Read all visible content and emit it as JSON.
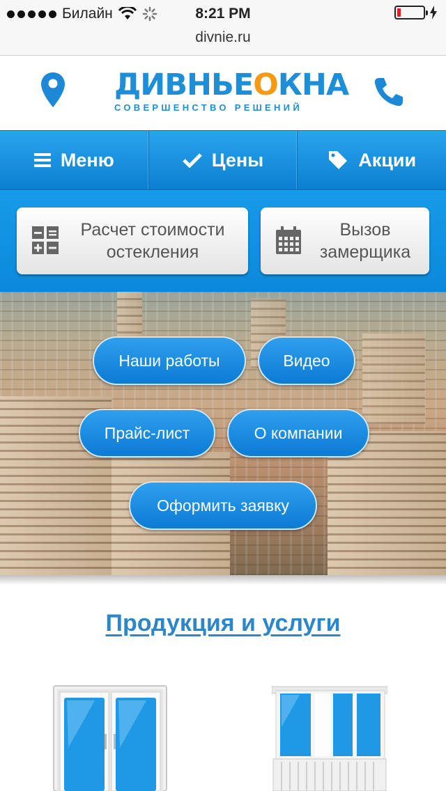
{
  "status_bar": {
    "carrier": "Билайн",
    "time": "8:21 PM",
    "battery_level": 0.15,
    "battery_color": "#e02020"
  },
  "url_bar": {
    "url": "divnie.ru"
  },
  "header": {
    "logo": {
      "main": "ДИВНЬЕОКНА",
      "sub": "СОВЕРШЕНСТВО РЕШЕНИЙ"
    },
    "icons": [
      "map-pin-icon",
      "phone-icon"
    ]
  },
  "nav": {
    "items": [
      {
        "label": "Меню",
        "icon": "hamburger-icon"
      },
      {
        "label": "Цены",
        "icon": "checkmark-icon"
      },
      {
        "label": "Акции",
        "icon": "tag-icon"
      }
    ]
  },
  "actions": {
    "calc": {
      "line1": "Расчет стоимости",
      "line2": "остекления",
      "icon": "calculator-icon"
    },
    "measure": {
      "line1": "Вызов",
      "line2": "замерщика",
      "icon": "calendar-icon"
    }
  },
  "hero": {
    "buttons": [
      "Наши работы",
      "Видео",
      "Прайс-лист",
      "О компании",
      "Оформить заявку"
    ]
  },
  "products": {
    "title": "Продукция и услуги"
  },
  "colors": {
    "accent": "#1e8fd6",
    "logo_orange": "#f59a14",
    "link": "#2b87c9"
  }
}
